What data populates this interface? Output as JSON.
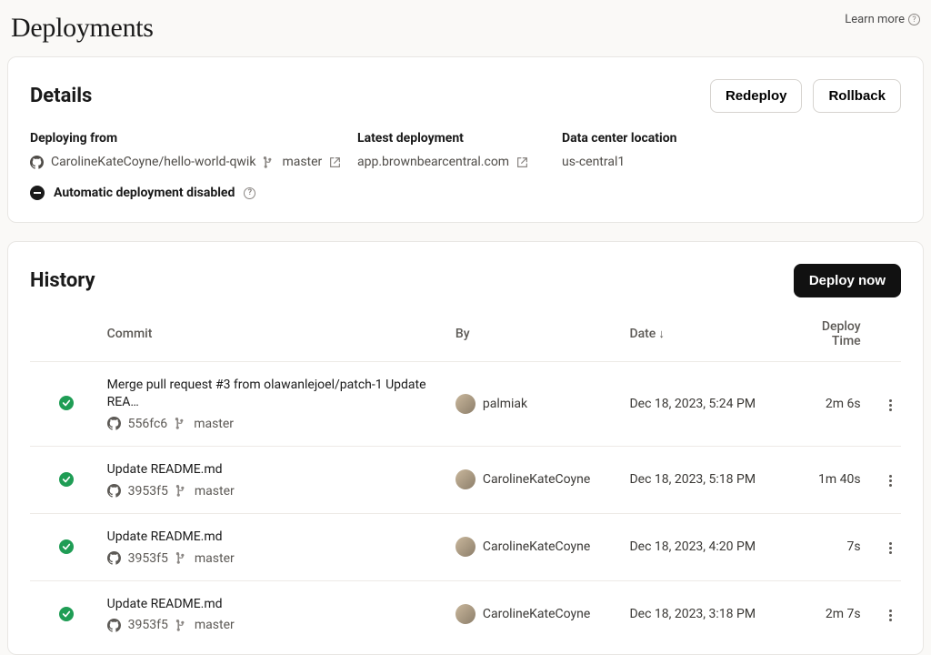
{
  "header": {
    "title": "Deployments",
    "learn_more": "Learn more"
  },
  "details": {
    "title": "Details",
    "redeploy_label": "Redeploy",
    "rollback_label": "Rollback",
    "deploying_from_label": "Deploying from",
    "repo": "CarolineKateCoyne/hello-world-qwik",
    "branch": "master",
    "latest_deployment_label": "Latest deployment",
    "latest_deployment_url": "app.brownbearcentral.com",
    "data_center_label": "Data center location",
    "data_center_value": "us-central1",
    "auto_deploy_text": "Automatic deployment disabled"
  },
  "history": {
    "title": "History",
    "deploy_now_label": "Deploy now",
    "columns": {
      "commit": "Commit",
      "by": "By",
      "date": "Date",
      "deploy_time": "Deploy Time"
    },
    "rows": [
      {
        "message": "Merge pull request #3 from olawanlejoel/patch-1 Update REA…",
        "hash": "556fc6",
        "branch": "master",
        "by": "palmiak",
        "date": "Dec 18, 2023, 5:24 PM",
        "deploy_time": "2m 6s"
      },
      {
        "message": "Update README.md",
        "hash": "3953f5",
        "branch": "master",
        "by": "CarolineKateCoyne",
        "date": "Dec 18, 2023, 5:18 PM",
        "deploy_time": "1m 40s"
      },
      {
        "message": "Update README.md",
        "hash": "3953f5",
        "branch": "master",
        "by": "CarolineKateCoyne",
        "date": "Dec 18, 2023, 4:20 PM",
        "deploy_time": "7s"
      },
      {
        "message": "Update README.md",
        "hash": "3953f5",
        "branch": "master",
        "by": "CarolineKateCoyne",
        "date": "Dec 18, 2023, 3:18 PM",
        "deploy_time": "2m 7s"
      }
    ]
  }
}
